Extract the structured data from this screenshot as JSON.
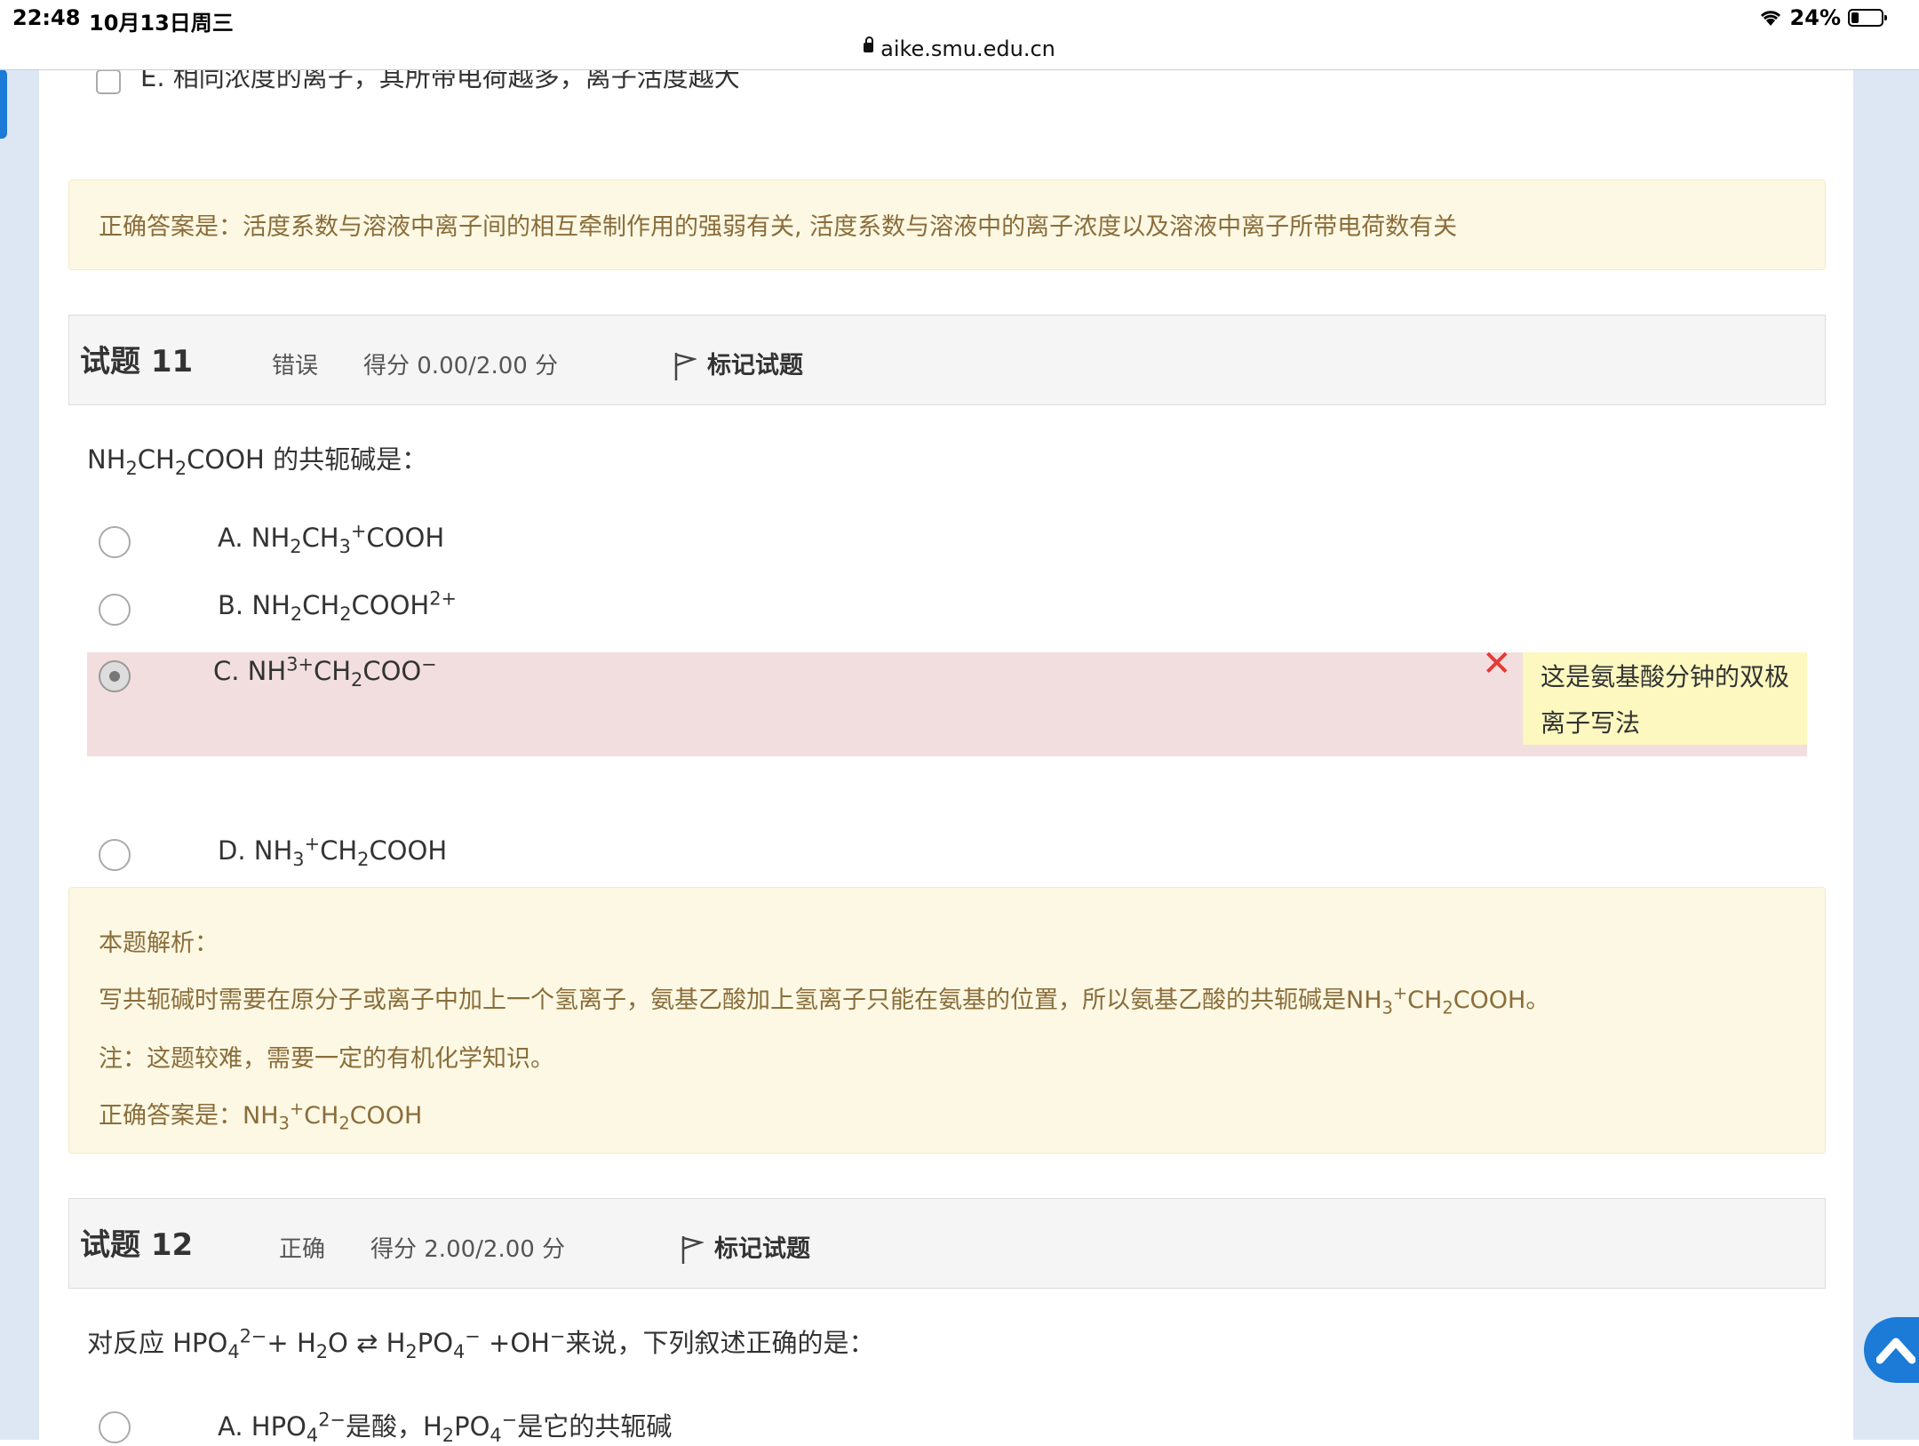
{
  "status_bar": {
    "time": "22:48",
    "date": "10月13日周三",
    "battery": "24%",
    "battery_level": 0.24
  },
  "browser": {
    "url": "aike.smu.edu.cn"
  },
  "prev_question": {
    "option_e": "E. 相同浓度的离子，其所带电荷越多，离子活度越大",
    "right_answer": "正确答案是：活度系数与溶液中离子间的相互牵制作用的强弱有关, 活度系数与溶液中的离子浓度以及溶液中离子所带电荷数有关"
  },
  "q11": {
    "label": "试题",
    "number": "11",
    "state": "错误",
    "grade": "得分 0.00/2.00 分",
    "flag_label": "标记试题",
    "question_suffix": " 的共轭碱是：",
    "specific_feedback": "这是氨基酸分钟的双极离子写法",
    "explanation_title": "本题解析：",
    "explanation_line1": "写共轭碱时需要在原分子或离子中加上一个氢离子，氨基乙酸加上氢离子只能在氨基的位置，所以氨基乙酸的共轭碱是NH",
    "explanation_note": "注：这题较难，需要一定的有机化学知识。",
    "answer_prefix": "正确答案是："
  },
  "q12": {
    "label": "试题",
    "number": "12",
    "state": "正确",
    "grade": "得分 2.00/2.00 分",
    "flag_label": "标记试题",
    "question_prefix": "对反应 HPO",
    "question_suffix": "来说，下列叙述正确的是：",
    "option_a_prefix": "A. HPO",
    "option_a_mid": "是酸，H",
    "option_a_suffix": "是它的共轭碱"
  },
  "colors": {
    "feedback_bg": "#fcf8e3",
    "feedback_text": "#8a6d3b",
    "wrong_bg": "#f2dede",
    "wrong_mark": "#e53935",
    "accent": "#1b7bd6"
  }
}
